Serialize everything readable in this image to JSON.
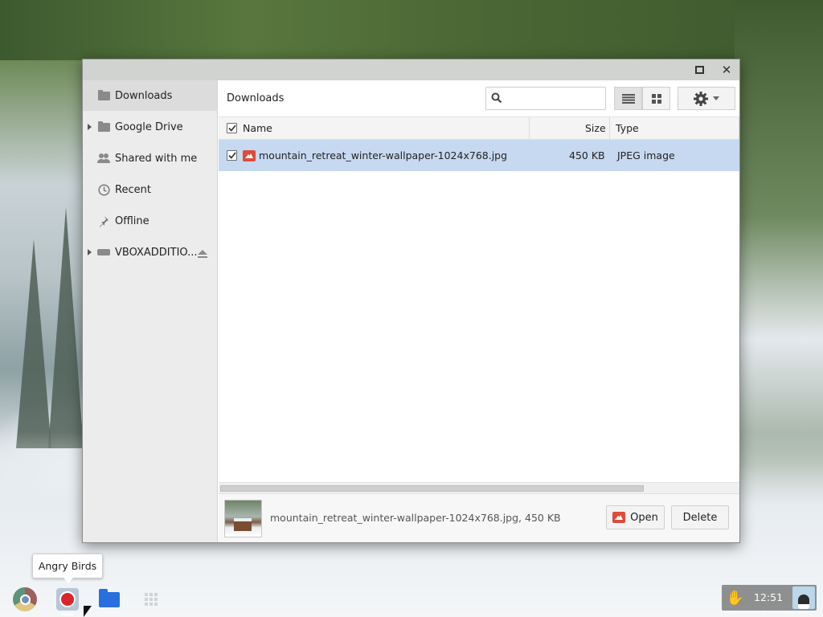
{
  "window": {
    "controls": {
      "maximize_icon": "maximize-icon",
      "close_icon": "close-icon",
      "close_glyph": "✕"
    }
  },
  "sidebar": {
    "items": [
      {
        "label": "Downloads",
        "icon": "download-folder-icon",
        "selected": true,
        "expandable": false
      },
      {
        "label": "Google Drive",
        "icon": "drive-folder-icon",
        "selected": false,
        "expandable": true
      },
      {
        "label": "Shared with me",
        "icon": "people-icon",
        "selected": false,
        "expandable": false
      },
      {
        "label": "Recent",
        "icon": "clock-icon",
        "selected": false,
        "expandable": false
      },
      {
        "label": "Offline",
        "icon": "pin-icon",
        "selected": false,
        "expandable": false
      },
      {
        "label": "VBOXADDITIO...",
        "icon": "drive-icon",
        "selected": false,
        "expandable": true,
        "ejectable": true
      }
    ]
  },
  "toolbar": {
    "breadcrumb": "Downloads",
    "search_placeholder": "",
    "search_value": "",
    "search_icon": "search-icon",
    "list_view_icon": "list-view-icon",
    "grid_view_icon": "grid-view-icon",
    "gear_icon": "gear-icon",
    "active_view": "list"
  },
  "columns": {
    "name": "Name",
    "size": "Size",
    "type": "Type"
  },
  "files": [
    {
      "name": "mountain_retreat_winter-wallpaper-1024x768.jpg",
      "size": "450 KB",
      "type": "JPEG image",
      "checked": true,
      "selected": true,
      "icon": "image-file-icon"
    }
  ],
  "preview": {
    "text": "mountain_retreat_winter-wallpaper-1024x768.jpg, 450 KB",
    "open_label": "Open",
    "delete_label": "Delete"
  },
  "tooltip": {
    "text": "Angry Birds"
  },
  "shelf": {
    "apps": [
      {
        "name": "Chrome",
        "icon": "chrome-icon"
      },
      {
        "name": "Angry Birds",
        "icon": "angry-birds-icon",
        "running": true
      },
      {
        "name": "Files",
        "icon": "files-folder-icon"
      },
      {
        "name": "App Launcher",
        "icon": "app-launcher-icon"
      }
    ],
    "clock": "12:51"
  },
  "colors": {
    "selection": "#c7d9f0",
    "sidebar_bg": "#ececec",
    "image_icon": "#dd4b39",
    "files_folder": "#2a6fe0"
  }
}
